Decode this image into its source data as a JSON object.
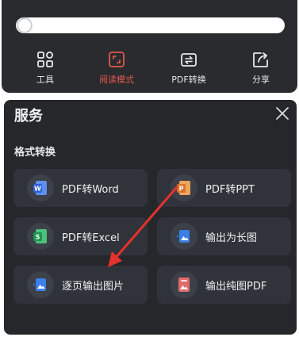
{
  "top_bar": {
    "cut_text": "· · · · · · · · · · · · ·",
    "progress": 0.0,
    "tools": [
      {
        "label": "工具",
        "icon": "grid-icon",
        "active": false
      },
      {
        "label": "阅读模式",
        "icon": "reading-mode-icon",
        "active": true
      },
      {
        "label": "PDF转换",
        "icon": "pdf-convert-icon",
        "active": false
      },
      {
        "label": "分享",
        "icon": "share-icon",
        "active": false
      }
    ]
  },
  "service_panel": {
    "title": "服务",
    "close_icon": "close-icon",
    "section_title": "格式转换",
    "items": [
      {
        "label": "PDF转Word",
        "icon": "word-icon",
        "color": "#3b6fe3"
      },
      {
        "label": "PDF转PPT",
        "icon": "ppt-icon",
        "color": "#e0873a"
      },
      {
        "label": "PDF转Excel",
        "icon": "excel-icon",
        "color": "#27a35a"
      },
      {
        "label": "输出为长图",
        "icon": "long-image-icon",
        "color": "#3b7fe8"
      },
      {
        "label": "逐页输出图片",
        "icon": "page-image-icon",
        "color": "#3b7fe8"
      },
      {
        "label": "输出纯图PDF",
        "icon": "image-pdf-icon",
        "color": "#e06b6b"
      }
    ]
  },
  "colors": {
    "accent": "#e0594c",
    "panel_bg": "#25272b",
    "card_bg": "#303339",
    "annotation_arrow": "#e5322d"
  }
}
